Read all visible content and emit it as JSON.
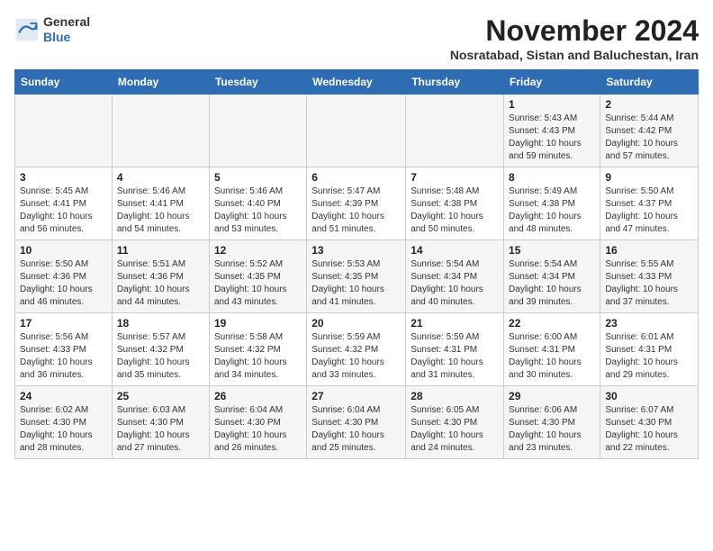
{
  "logo": {
    "line1": "General",
    "line2": "Blue"
  },
  "title": "November 2024",
  "location": "Nosratabad, Sistan and Baluchestan, Iran",
  "headers": [
    "Sunday",
    "Monday",
    "Tuesday",
    "Wednesday",
    "Thursday",
    "Friday",
    "Saturday"
  ],
  "weeks": [
    [
      {
        "day": "",
        "info": ""
      },
      {
        "day": "",
        "info": ""
      },
      {
        "day": "",
        "info": ""
      },
      {
        "day": "",
        "info": ""
      },
      {
        "day": "",
        "info": ""
      },
      {
        "day": "1",
        "info": "Sunrise: 5:43 AM\nSunset: 4:43 PM\nDaylight: 10 hours\nand 59 minutes."
      },
      {
        "day": "2",
        "info": "Sunrise: 5:44 AM\nSunset: 4:42 PM\nDaylight: 10 hours\nand 57 minutes."
      }
    ],
    [
      {
        "day": "3",
        "info": "Sunrise: 5:45 AM\nSunset: 4:41 PM\nDaylight: 10 hours\nand 56 minutes."
      },
      {
        "day": "4",
        "info": "Sunrise: 5:46 AM\nSunset: 4:41 PM\nDaylight: 10 hours\nand 54 minutes."
      },
      {
        "day": "5",
        "info": "Sunrise: 5:46 AM\nSunset: 4:40 PM\nDaylight: 10 hours\nand 53 minutes."
      },
      {
        "day": "6",
        "info": "Sunrise: 5:47 AM\nSunset: 4:39 PM\nDaylight: 10 hours\nand 51 minutes."
      },
      {
        "day": "7",
        "info": "Sunrise: 5:48 AM\nSunset: 4:38 PM\nDaylight: 10 hours\nand 50 minutes."
      },
      {
        "day": "8",
        "info": "Sunrise: 5:49 AM\nSunset: 4:38 PM\nDaylight: 10 hours\nand 48 minutes."
      },
      {
        "day": "9",
        "info": "Sunrise: 5:50 AM\nSunset: 4:37 PM\nDaylight: 10 hours\nand 47 minutes."
      }
    ],
    [
      {
        "day": "10",
        "info": "Sunrise: 5:50 AM\nSunset: 4:36 PM\nDaylight: 10 hours\nand 46 minutes."
      },
      {
        "day": "11",
        "info": "Sunrise: 5:51 AM\nSunset: 4:36 PM\nDaylight: 10 hours\nand 44 minutes."
      },
      {
        "day": "12",
        "info": "Sunrise: 5:52 AM\nSunset: 4:35 PM\nDaylight: 10 hours\nand 43 minutes."
      },
      {
        "day": "13",
        "info": "Sunrise: 5:53 AM\nSunset: 4:35 PM\nDaylight: 10 hours\nand 41 minutes."
      },
      {
        "day": "14",
        "info": "Sunrise: 5:54 AM\nSunset: 4:34 PM\nDaylight: 10 hours\nand 40 minutes."
      },
      {
        "day": "15",
        "info": "Sunrise: 5:54 AM\nSunset: 4:34 PM\nDaylight: 10 hours\nand 39 minutes."
      },
      {
        "day": "16",
        "info": "Sunrise: 5:55 AM\nSunset: 4:33 PM\nDaylight: 10 hours\nand 37 minutes."
      }
    ],
    [
      {
        "day": "17",
        "info": "Sunrise: 5:56 AM\nSunset: 4:33 PM\nDaylight: 10 hours\nand 36 minutes."
      },
      {
        "day": "18",
        "info": "Sunrise: 5:57 AM\nSunset: 4:32 PM\nDaylight: 10 hours\nand 35 minutes."
      },
      {
        "day": "19",
        "info": "Sunrise: 5:58 AM\nSunset: 4:32 PM\nDaylight: 10 hours\nand 34 minutes."
      },
      {
        "day": "20",
        "info": "Sunrise: 5:59 AM\nSunset: 4:32 PM\nDaylight: 10 hours\nand 33 minutes."
      },
      {
        "day": "21",
        "info": "Sunrise: 5:59 AM\nSunset: 4:31 PM\nDaylight: 10 hours\nand 31 minutes."
      },
      {
        "day": "22",
        "info": "Sunrise: 6:00 AM\nSunset: 4:31 PM\nDaylight: 10 hours\nand 30 minutes."
      },
      {
        "day": "23",
        "info": "Sunrise: 6:01 AM\nSunset: 4:31 PM\nDaylight: 10 hours\nand 29 minutes."
      }
    ],
    [
      {
        "day": "24",
        "info": "Sunrise: 6:02 AM\nSunset: 4:30 PM\nDaylight: 10 hours\nand 28 minutes."
      },
      {
        "day": "25",
        "info": "Sunrise: 6:03 AM\nSunset: 4:30 PM\nDaylight: 10 hours\nand 27 minutes."
      },
      {
        "day": "26",
        "info": "Sunrise: 6:04 AM\nSunset: 4:30 PM\nDaylight: 10 hours\nand 26 minutes."
      },
      {
        "day": "27",
        "info": "Sunrise: 6:04 AM\nSunset: 4:30 PM\nDaylight: 10 hours\nand 25 minutes."
      },
      {
        "day": "28",
        "info": "Sunrise: 6:05 AM\nSunset: 4:30 PM\nDaylight: 10 hours\nand 24 minutes."
      },
      {
        "day": "29",
        "info": "Sunrise: 6:06 AM\nSunset: 4:30 PM\nDaylight: 10 hours\nand 23 minutes."
      },
      {
        "day": "30",
        "info": "Sunrise: 6:07 AM\nSunset: 4:30 PM\nDaylight: 10 hours\nand 22 minutes."
      }
    ]
  ]
}
